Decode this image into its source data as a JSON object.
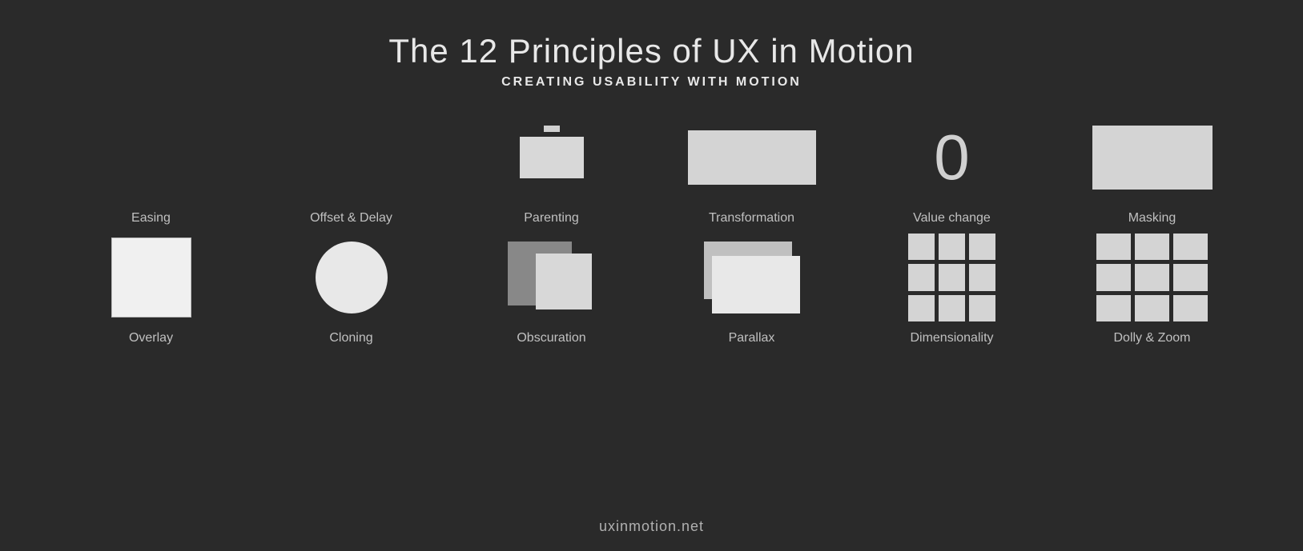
{
  "header": {
    "title": "The 12 Principles of UX in Motion",
    "subtitle": "CREATING USABILITY WITH MOTION"
  },
  "row1": [
    {
      "id": "easing",
      "label": "Easing"
    },
    {
      "id": "offset-delay",
      "label": "Offset & Delay"
    },
    {
      "id": "parenting",
      "label": "Parenting"
    },
    {
      "id": "transformation",
      "label": "Transformation"
    },
    {
      "id": "value-change",
      "label": "Value change"
    },
    {
      "id": "masking",
      "label": "Masking"
    }
  ],
  "row2": [
    {
      "id": "overlay",
      "label": "Overlay"
    },
    {
      "id": "cloning",
      "label": "Cloning"
    },
    {
      "id": "obscuration",
      "label": "Obscuration"
    },
    {
      "id": "parallax",
      "label": "Parallax"
    },
    {
      "id": "dimensionality",
      "label": "Dimensionality"
    },
    {
      "id": "dolly-zoom",
      "label": "Dolly & Zoom"
    }
  ],
  "footer": {
    "url": "uxinmotion.net"
  }
}
